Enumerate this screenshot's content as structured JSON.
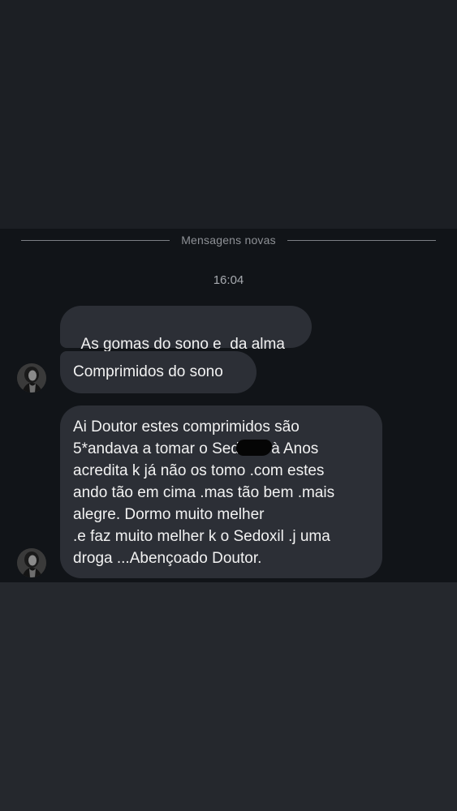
{
  "chat": {
    "new_messages_divider": "Mensagens novas",
    "timestamp": "16:04",
    "messages": [
      {
        "text": "As gomas do sono e  da alma"
      },
      {
        "text": "Comprimidos do sono"
      },
      {
        "lines": [
          "Ai Doutor estes comprimidos são",
          "5*andava a tomar o Sed",
          "à Anos",
          "acredita k já não os tomo .com estes",
          "ando tão em cima .mas tão bem .mais",
          "alegre. Dormo muito melher",
          ".e faz muito melher k o Sedoxil .j uma",
          "droga ...Abençoado Doutor."
        ]
      }
    ]
  },
  "colors": {
    "bubble": "#2c2f36",
    "chat_background": "#111418",
    "text": "#f2f2f2"
  }
}
